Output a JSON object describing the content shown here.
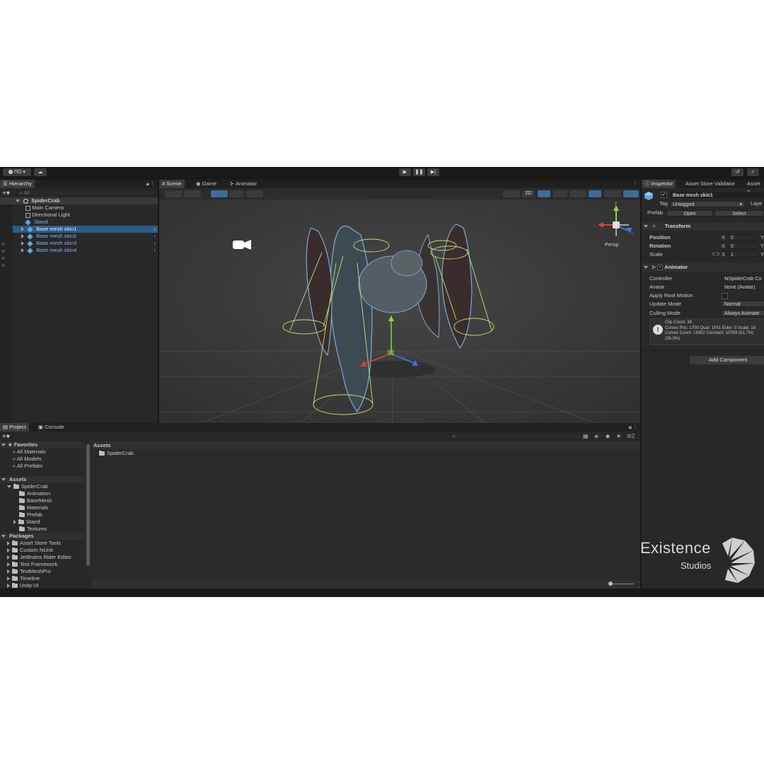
{
  "toolbar": {
    "account_label": "ПО",
    "play_icon": "play-icon",
    "pause_icon": "pause-icon",
    "step_icon": "step-icon"
  },
  "hierarchy": {
    "tab": "Hierarchy",
    "search_placeholder": "All",
    "root": "SpiderCrab",
    "items": [
      {
        "label": "Main Camera"
      },
      {
        "label": "Directional Light"
      },
      {
        "label": "Stand"
      },
      {
        "label": "Base mesh skin1"
      },
      {
        "label": "Base mesh skin2"
      },
      {
        "label": "Base mesh skin3"
      },
      {
        "label": "Base mesh skin4"
      }
    ]
  },
  "scene": {
    "tabs": [
      {
        "label": "Scene"
      },
      {
        "label": "Game"
      },
      {
        "label": "Animator"
      }
    ],
    "toggle_2d": "2D",
    "persp_label": "Persp",
    "gizmo_axes": {
      "x": "x",
      "y": "y",
      "z": "z"
    }
  },
  "inspector": {
    "tabs": [
      {
        "label": "Inspector"
      },
      {
        "label": "Asset Store Validator"
      },
      {
        "label": "Asset S"
      }
    ],
    "object_name": "Base mesh skin1",
    "tag_label": "Tag",
    "tag_value": "Untagged",
    "layer_label": "Laye",
    "prefab_label": "Prefab",
    "open_button": "Open",
    "select_button": "Select",
    "transform": {
      "title": "Transform",
      "position_label": "Position",
      "rotation_label": "Rotation",
      "scale_label": "Scale",
      "position_x": "0",
      "rotation_x": "0",
      "scale_x": "1",
      "x_label": "X",
      "y_label": "Y"
    },
    "animator": {
      "title": "Animator",
      "controller_label": "Controller",
      "controller_value": "SpiderCrab Co",
      "avatar_label": "Avatar",
      "avatar_value": "None (Avatar)",
      "apply_root_label": "Apply Root Motion",
      "update_mode_label": "Update Mode",
      "update_mode_value": "Normal",
      "culling_mode_label": "Culling Mode",
      "culling_mode_value": "Always Animate",
      "info_line1": "Clip Count: 34",
      "info_line2": "Curves Pos: 1700 Quat: 1551 Euler: 0 Scale: 18",
      "info_line3": "Curves Count: 16302 Constant: 10059 (61.7%)",
      "info_line4": "(38.3%)"
    },
    "add_component": "Add Component"
  },
  "project": {
    "tabs": [
      {
        "label": "Project"
      },
      {
        "label": "Console"
      }
    ],
    "favorites_label": "Favorites",
    "favorites": [
      {
        "label": "All Materials"
      },
      {
        "label": "All Models"
      },
      {
        "label": "All Prefabs"
      }
    ],
    "assets_label": "Assets",
    "spidercrab_label": "SpiderCrab",
    "spidercrab_children": [
      {
        "label": "Animation"
      },
      {
        "label": "BaseMesh"
      },
      {
        "label": "Materials"
      },
      {
        "label": "Prefab"
      },
      {
        "label": "Stand"
      },
      {
        "label": "Textures"
      }
    ],
    "packages_label": "Packages",
    "packages": [
      {
        "label": "Asset Store Tools"
      },
      {
        "label": "Custom NUnit"
      },
      {
        "label": "JetBrains Rider Editor"
      },
      {
        "label": "Test Framework"
      },
      {
        "label": "TextMeshPro"
      },
      {
        "label": "Timeline"
      },
      {
        "label": "Unity UI"
      }
    ],
    "breadcrumb": "Assets",
    "grid_item": "SpiderCrab",
    "hidden_count": "2"
  },
  "watermark": {
    "line1": "Existence",
    "line2": "Studios"
  },
  "colors": {
    "accent_blue": "#2c5d87",
    "prefab_blue": "#7cb8ef",
    "scene_bg": "#3a3a3a"
  }
}
